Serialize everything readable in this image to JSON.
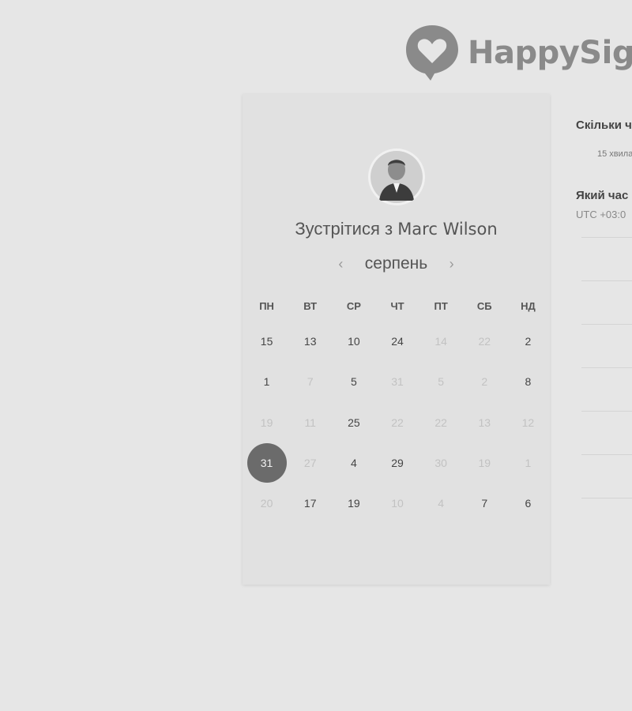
{
  "brand": {
    "name": "HappySig"
  },
  "meeting": {
    "title_prefix": "Зустрітися з",
    "host": "Marc Wilson"
  },
  "calendar": {
    "month": "серпень",
    "prev_icon": "chevron-left-icon",
    "next_icon": "chevron-right-icon",
    "weekdays": [
      "ПН",
      "ВТ",
      "СР",
      "ЧТ",
      "ПТ",
      "СБ",
      "НД"
    ],
    "weeks": [
      [
        {
          "d": "15",
          "a": true
        },
        {
          "d": "13",
          "a": true
        },
        {
          "d": "10",
          "a": true
        },
        {
          "d": "24",
          "a": true
        },
        {
          "d": "14",
          "a": false
        },
        {
          "d": "22",
          "a": false
        },
        {
          "d": "2",
          "a": true
        }
      ],
      [
        {
          "d": "1",
          "a": true
        },
        {
          "d": "7",
          "a": false
        },
        {
          "d": "5",
          "a": true
        },
        {
          "d": "31",
          "a": false
        },
        {
          "d": "5",
          "a": false
        },
        {
          "d": "2",
          "a": false
        },
        {
          "d": "8",
          "a": true
        }
      ],
      [
        {
          "d": "19",
          "a": false
        },
        {
          "d": "11",
          "a": false
        },
        {
          "d": "25",
          "a": true
        },
        {
          "d": "22",
          "a": false
        },
        {
          "d": "22",
          "a": false
        },
        {
          "d": "13",
          "a": false
        },
        {
          "d": "12",
          "a": false
        }
      ],
      [
        {
          "d": "31",
          "a": true,
          "s": true
        },
        {
          "d": "27",
          "a": false
        },
        {
          "d": "4",
          "a": true
        },
        {
          "d": "29",
          "a": true
        },
        {
          "d": "30",
          "a": false
        },
        {
          "d": "19",
          "a": false
        },
        {
          "d": "1",
          "a": false
        }
      ],
      [
        {
          "d": "20",
          "a": false
        },
        {
          "d": "17",
          "a": true
        },
        {
          "d": "19",
          "a": true
        },
        {
          "d": "10",
          "a": false
        },
        {
          "d": "4",
          "a": false
        },
        {
          "d": "7",
          "a": true
        },
        {
          "d": "6",
          "a": true
        }
      ]
    ]
  },
  "side": {
    "duration_question": "Скільки ч",
    "duration_option": "15 хвила",
    "time_question": "Який час",
    "timezone": "UTC +03:0"
  }
}
